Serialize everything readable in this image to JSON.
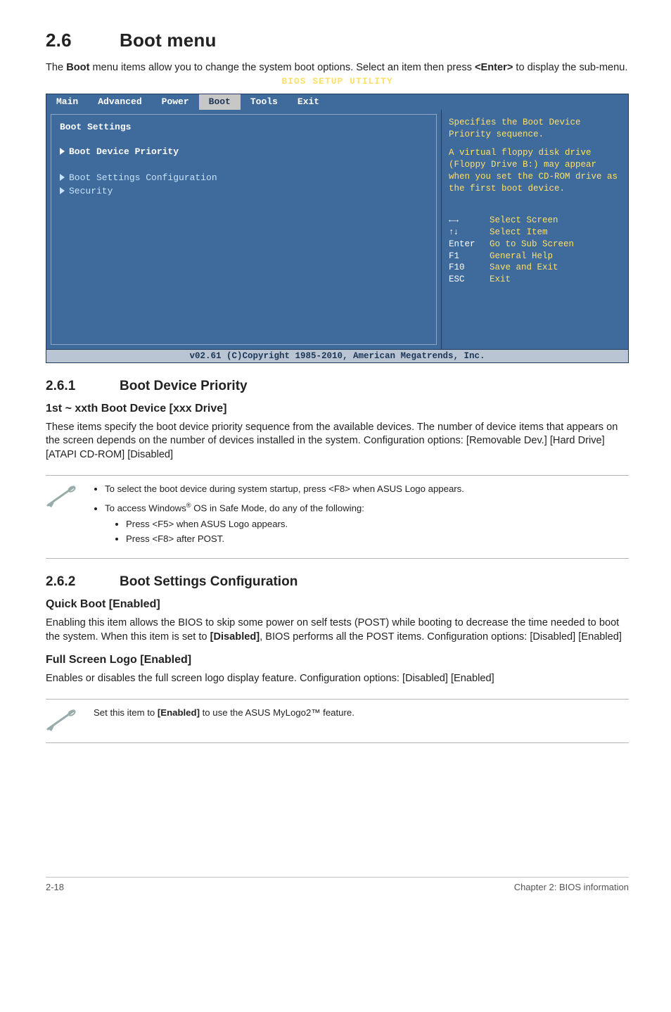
{
  "h1_num": "2.6",
  "h1_title": "Boot menu",
  "intro_a": "The ",
  "intro_b": "Boot",
  "intro_c": " menu items allow you to change the system boot options. Select an item then press ",
  "intro_d": "<Enter>",
  "intro_e": " to display the sub-menu.",
  "bios": {
    "title": "BIOS SETUP UTILITY",
    "tabs": [
      "Main",
      "Advanced",
      "Power",
      "Boot",
      "Tools",
      "Exit"
    ],
    "active_tab_index": 3,
    "left_heading": "Boot Settings",
    "items": [
      {
        "label": "Boot Device Priority",
        "selected": true
      },
      {
        "label": "Boot Settings Configuration",
        "selected": false
      },
      {
        "label": "Security",
        "selected": false
      }
    ],
    "help1": "Specifies the Boot Device Priority sequence.",
    "help2": "A virtual floppy disk drive (Floppy Drive B:) may appear when you set the CD-ROM drive as the first boot device.",
    "nav": [
      {
        "key": "←→",
        "txt": "Select Screen",
        "cls": "arrows-lr"
      },
      {
        "key": "↑↓",
        "txt": "Select Item",
        "cls": "arrows-ud"
      },
      {
        "key": "Enter",
        "txt": "Go to Sub Screen",
        "cls": ""
      },
      {
        "key": "F1",
        "txt": "General Help",
        "cls": ""
      },
      {
        "key": "F10",
        "txt": "Save and Exit",
        "cls": ""
      },
      {
        "key": "ESC",
        "txt": "Exit",
        "cls": ""
      }
    ],
    "footer": "v02.61 (C)Copyright 1985-2010, American Megatrends, Inc."
  },
  "s261_num": "2.6.1",
  "s261_title": "Boot Device Priority",
  "s261_h3": "1st ~ xxth Boot Device [xxx Drive]",
  "s261_p": "These items specify the boot device priority sequence from the available devices. The number of device items that appears on the screen depends on the number of devices installed in the system. Configuration options: [Removable Dev.] [Hard Drive] [ATAPI CD-ROM] [Disabled]",
  "note1_li1": "To select the boot device during system startup, press <F8> when ASUS Logo appears.",
  "note1_li2_a": "To access Windows",
  "note1_li2_b": " OS in Safe Mode, do any of the following:",
  "note1_sub1": "Press <F5> when ASUS Logo appears.",
  "note1_sub2": "Press <F8> after POST.",
  "s262_num": "2.6.2",
  "s262_title": "Boot Settings Configuration",
  "s262_h3a": "Quick Boot [Enabled]",
  "s262_pa_1": "Enabling this item allows the BIOS to skip some power on self tests (POST) while booting to decrease the time needed to boot the system. When this item is set to ",
  "s262_pa_2": "[Disabled]",
  "s262_pa_3": ", BIOS performs all the POST items. Configuration options: [Disabled] [Enabled]",
  "s262_h3b": "Full Screen Logo [Enabled]",
  "s262_pb": "Enables or disables the full screen logo display feature. Configuration options: [Disabled] [Enabled]",
  "note2_a": "Set this item to ",
  "note2_b": "[Enabled]",
  "note2_c": " to use the ASUS MyLogo2™ feature.",
  "footer_left": "2-18",
  "footer_right": "Chapter 2: BIOS information"
}
